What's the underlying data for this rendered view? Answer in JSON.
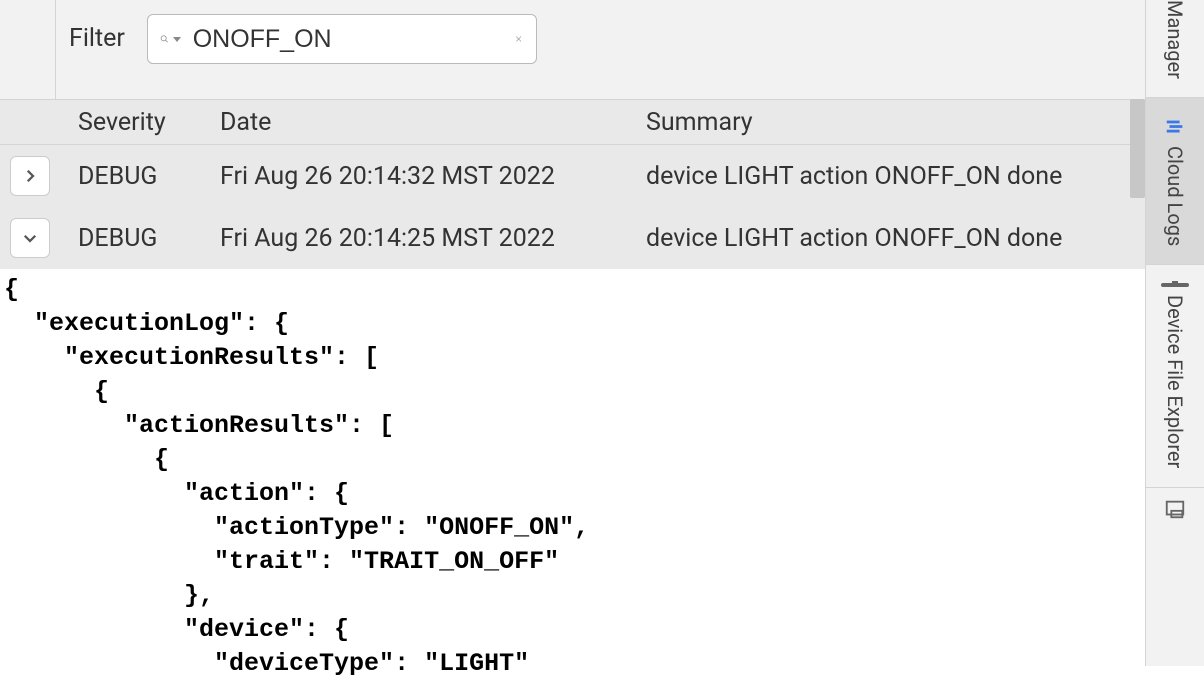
{
  "filter": {
    "label": "Filter",
    "value": "ONOFF_ON"
  },
  "columns": {
    "severity": "Severity",
    "date": "Date",
    "summary": "Summary"
  },
  "rows": [
    {
      "severity": "DEBUG",
      "date": "Fri Aug 26 20:14:32 MST 2022",
      "summary": "device LIGHT action ONOFF_ON done",
      "expanded": false
    },
    {
      "severity": "DEBUG",
      "date": "Fri Aug 26 20:14:25 MST 2022",
      "summary": "device LIGHT action ONOFF_ON done",
      "expanded": true
    }
  ],
  "json_body": "{\n  \"executionLog\": {\n    \"executionResults\": [\n      {\n        \"actionResults\": [\n          {\n            \"action\": {\n              \"actionType\": \"ONOFF_ON\",\n              \"trait\": \"TRAIT_ON_OFF\"\n            },\n            \"device\": {\n              \"deviceType\": \"LIGHT\"",
  "sidebar": {
    "tab0": "Manager",
    "tab1": "Cloud Logs",
    "tab2": "Device File Explorer"
  }
}
